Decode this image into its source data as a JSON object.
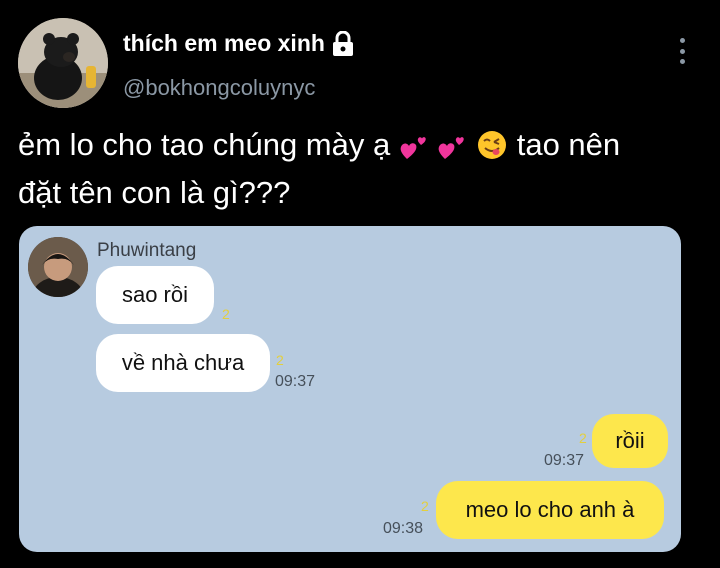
{
  "tweet": {
    "display_name": "thích em meo xinh",
    "handle": "@bokhongcoluynyc",
    "text_line1": "ẻm lo cho tao chúng mày ạ",
    "text_line1_tail": "tao nên",
    "text_line2": "đặt tên con là gì???",
    "emojis": [
      "two-hearts",
      "two-hearts",
      "savoring-food-face"
    ]
  },
  "chat": {
    "sender_name": "Phuwintang",
    "messages": [
      {
        "side": "left",
        "text": "sao rồi",
        "unread": "2",
        "time": ""
      },
      {
        "side": "left",
        "text": "về nhà chưa",
        "unread": "2",
        "time": "09:37"
      },
      {
        "side": "right",
        "text": "rồii",
        "unread": "2",
        "time": "09:37"
      },
      {
        "side": "right",
        "text": "meo lo cho anh à",
        "unread": "2",
        "time": "09:38"
      }
    ]
  },
  "colors": {
    "background": "#000000",
    "chat_background": "#b7cbe0",
    "outgoing_bubble": "#fde74c",
    "incoming_bubble": "#ffffff",
    "muted_text": "#8b98a5"
  }
}
